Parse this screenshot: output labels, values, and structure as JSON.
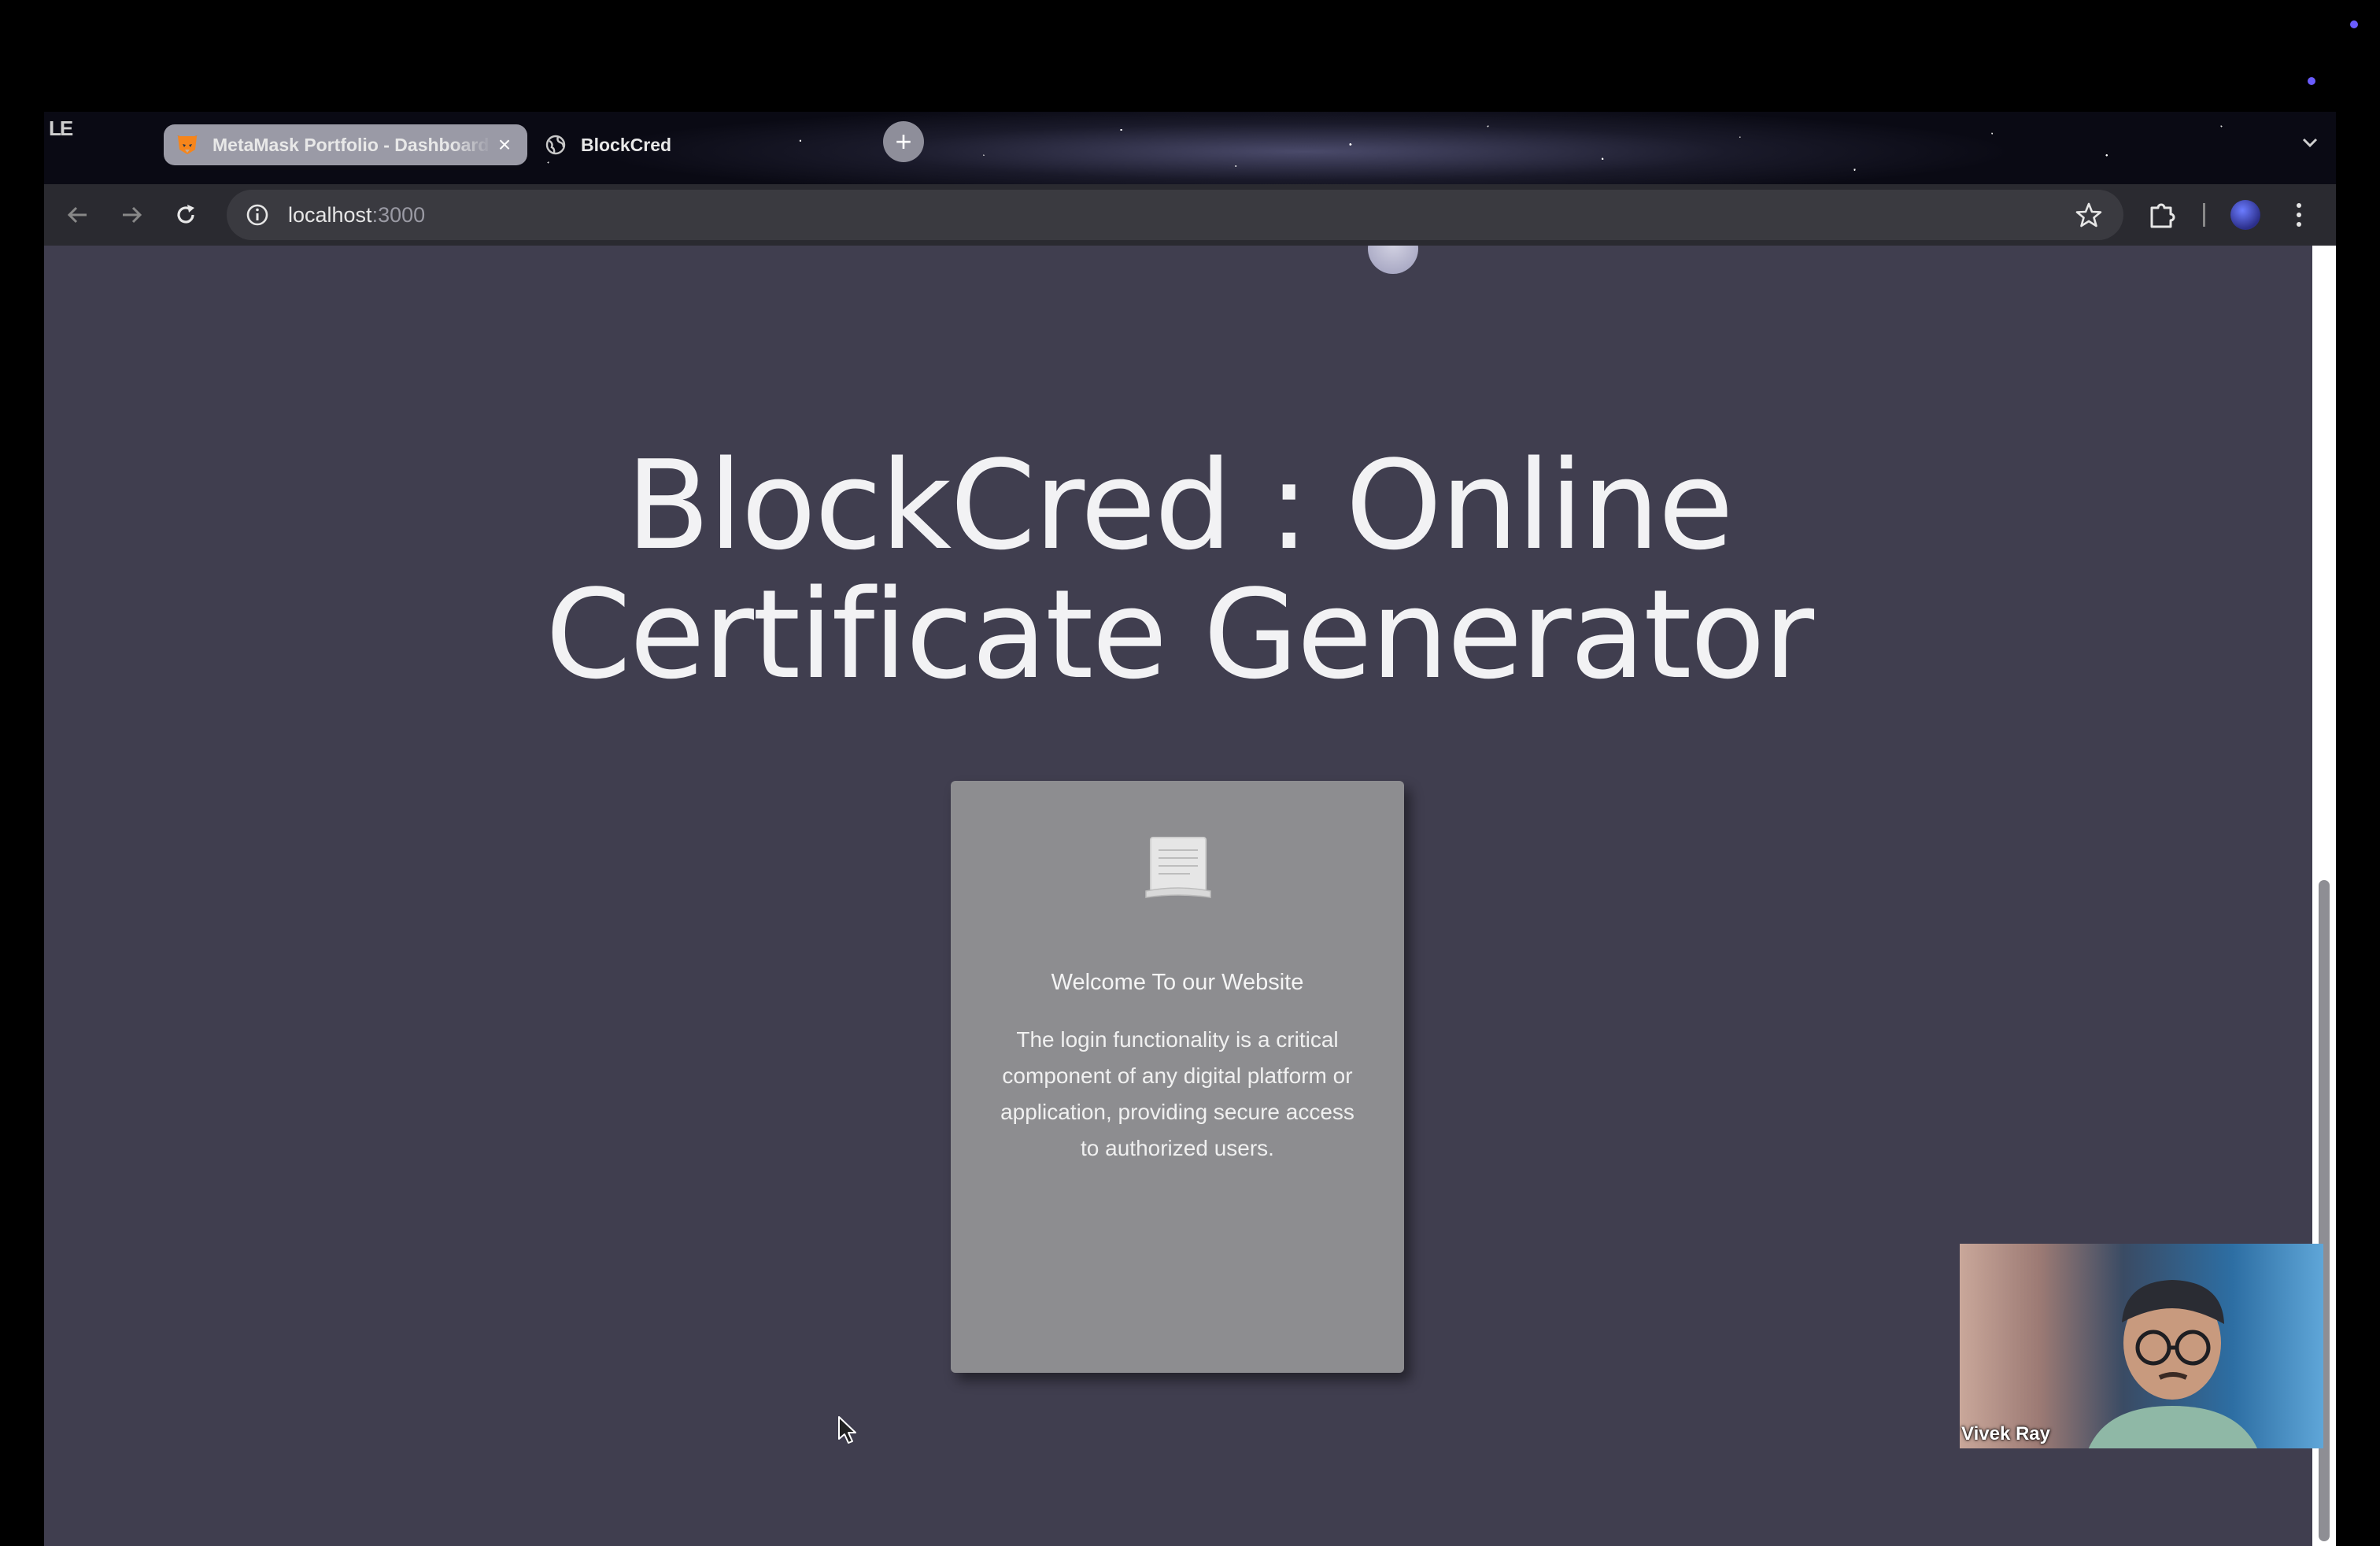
{
  "os": {
    "corner_mark": "LE"
  },
  "browser": {
    "tabs": [
      {
        "title": "MetaMask Portfolio - Dashboard",
        "icon": "metamask-fox-icon",
        "active": true,
        "close": "×"
      },
      {
        "title": "BlockCred",
        "icon": "globe-icon",
        "active": false,
        "close": "×"
      }
    ],
    "new_tab": "+",
    "address": {
      "host": "localhost",
      "port": ":3000"
    }
  },
  "page": {
    "title_line1": "BlockCred : Online",
    "title_line2": "Certificate Generator",
    "card": {
      "icon": "certificate-scroll-icon",
      "heading": "Welcome To our Website",
      "body": "The login functionality is a critical component of any digital platform or application, providing secure access to authorized users."
    }
  },
  "webcam": {
    "name": "Vivek Ray"
  },
  "colors": {
    "page_background": "#403e4f",
    "card_background": "#8d8d90",
    "title_text": "#f2f2f4",
    "tab_active": "#9a9aa6",
    "toolbar": "#2a2a30"
  }
}
